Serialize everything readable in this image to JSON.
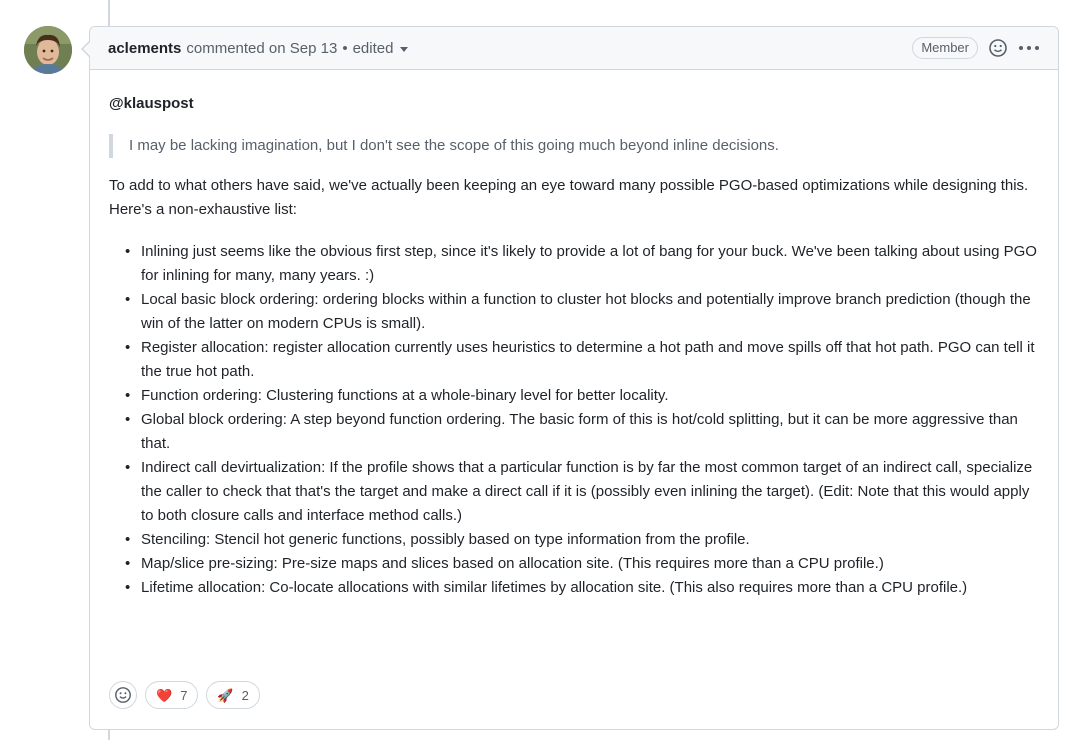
{
  "comment": {
    "author": "aclements",
    "action": "commented on",
    "date": "Sep 13",
    "separator": "•",
    "edited": "edited",
    "badge": "Member",
    "more_icon": "kebab-horizontal-icon",
    "mention": "@klauspost",
    "quote": "I may be lacking imagination, but I don't see the scope of this going much beyond inline decisions.",
    "intro": "To add to what others have said, we've actually been keeping an eye toward many possible PGO-based optimizations while designing this. Here's a non-exhaustive list:",
    "items": [
      "Inlining just seems like the obvious first step, since it's likely to provide a lot of bang for your buck. We've been talking about using PGO for inlining for many, many years. :)",
      "Local basic block ordering: ordering blocks within a function to cluster hot blocks and potentially improve branch prediction (though the win of the latter on modern CPUs is small).",
      "Register allocation: register allocation currently uses heuristics to determine a hot path and move spills off that hot path. PGO can tell it the true hot path.",
      "Function ordering: Clustering functions at a whole-binary level for better locality.",
      "Global block ordering: A step beyond function ordering. The basic form of this is hot/cold splitting, but it can be more aggressive than that.",
      "Indirect call devirtualization: If the profile shows that a particular function is by far the most common target of an indirect call, specialize the caller to check that that's the target and make a direct call if it is (possibly even inlining the target). (Edit: Note that this would apply to both closure calls and interface method calls.)",
      "Stenciling: Stencil hot generic functions, possibly based on type information from the profile.",
      "Map/slice pre-sizing: Pre-size maps and slices based on allocation site. (This requires more than a CPU profile.)",
      "Lifetime allocation: Co-locate allocations with similar lifetimes by allocation site. (This also requires more than a CPU profile.)"
    ]
  },
  "reactions": {
    "add_icon": "smiley-icon",
    "heart": {
      "emoji": "❤️",
      "count": "7"
    },
    "rocket": {
      "emoji": "🚀",
      "count": "2"
    }
  },
  "colors": {
    "border": "#d0d7de",
    "header_bg": "#f6f8fa",
    "muted_text": "#57606a",
    "text": "#1f2328",
    "heart": "#e0263b"
  }
}
